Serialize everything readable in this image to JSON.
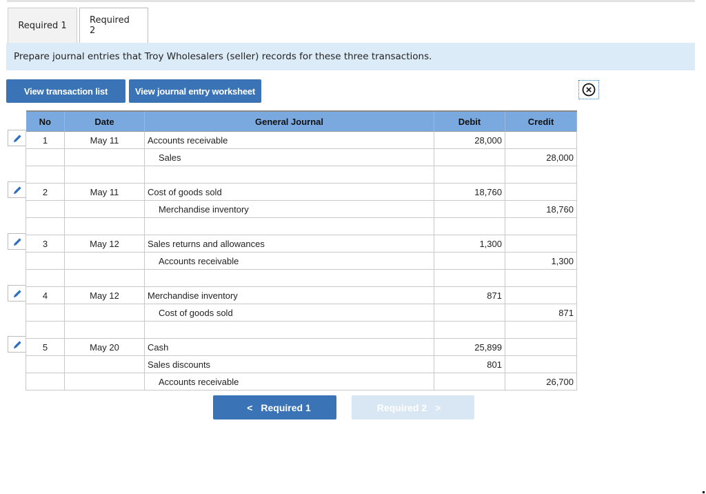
{
  "tabs": [
    {
      "label": "Required 1",
      "active": false
    },
    {
      "label": "Required 2",
      "active": true
    }
  ],
  "instruction": "Prepare journal entries that Troy Wholesalers (seller) records for these three transactions.",
  "buttons": {
    "view_transaction_list": "View transaction list",
    "view_journal_entry_worksheet": "View journal entry worksheet"
  },
  "close_icon": "circled-x-icon",
  "journal": {
    "headers": {
      "no": "No",
      "date": "Date",
      "general_journal": "General Journal",
      "debit": "Debit",
      "credit": "Credit"
    },
    "rows": [
      {
        "no": "1",
        "date": "May 11",
        "account": "Accounts receivable",
        "debit": "28,000",
        "credit": "",
        "indent": false
      },
      {
        "no": "",
        "date": "",
        "account": "Sales",
        "debit": "",
        "credit": "28,000",
        "indent": true
      },
      {
        "no": "",
        "date": "",
        "account": "",
        "debit": "",
        "credit": "",
        "indent": false
      },
      {
        "no": "2",
        "date": "May 11",
        "account": "Cost of goods sold",
        "debit": "18,760",
        "credit": "",
        "indent": false
      },
      {
        "no": "",
        "date": "",
        "account": "Merchandise inventory",
        "debit": "",
        "credit": "18,760",
        "indent": true
      },
      {
        "no": "",
        "date": "",
        "account": "",
        "debit": "",
        "credit": "",
        "indent": false
      },
      {
        "no": "3",
        "date": "May 12",
        "account": "Sales returns and allowances",
        "debit": "1,300",
        "credit": "",
        "indent": false
      },
      {
        "no": "",
        "date": "",
        "account": "Accounts receivable",
        "debit": "",
        "credit": "1,300",
        "indent": true
      },
      {
        "no": "",
        "date": "",
        "account": "",
        "debit": "",
        "credit": "",
        "indent": false
      },
      {
        "no": "4",
        "date": "May 12",
        "account": "Merchandise inventory",
        "debit": "871",
        "credit": "",
        "indent": false
      },
      {
        "no": "",
        "date": "",
        "account": "Cost of goods sold",
        "debit": "",
        "credit": "871",
        "indent": true
      },
      {
        "no": "",
        "date": "",
        "account": "",
        "debit": "",
        "credit": "",
        "indent": false
      },
      {
        "no": "5",
        "date": "May 20",
        "account": "Cash",
        "debit": "25,899",
        "credit": "",
        "indent": false
      },
      {
        "no": "",
        "date": "",
        "account": "Sales discounts",
        "debit": "801",
        "credit": "",
        "indent": false
      },
      {
        "no": "",
        "date": "",
        "account": "Accounts receivable",
        "debit": "",
        "credit": "26,700",
        "indent": true
      }
    ]
  },
  "nav": {
    "prev_label": "Required 1",
    "next_label": "Required 2",
    "prev_icon": "<",
    "next_icon": ">"
  }
}
